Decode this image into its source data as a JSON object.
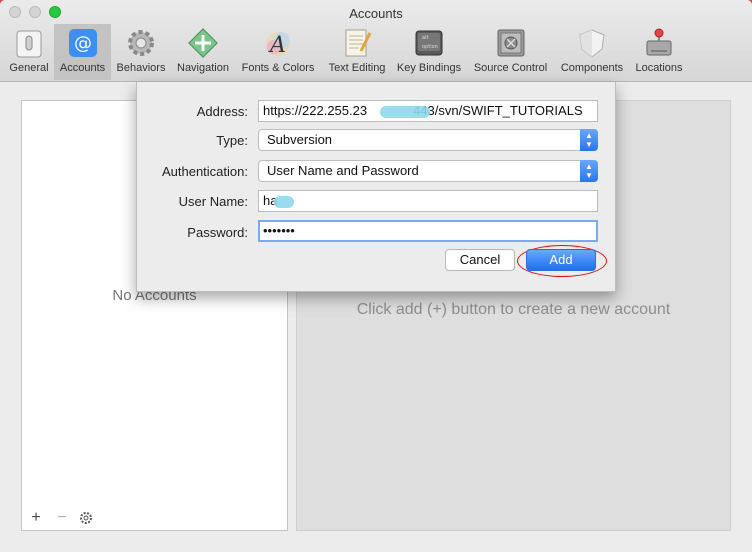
{
  "window": {
    "title": "Accounts"
  },
  "toolbar": {
    "items": [
      {
        "label": "General",
        "icon": "general-switch-icon",
        "active": false
      },
      {
        "label": "Accounts",
        "icon": "at-sign-icon",
        "active": true
      },
      {
        "label": "Behaviors",
        "icon": "gear-icon",
        "active": false
      },
      {
        "label": "Navigation",
        "icon": "navigation-arrows-icon",
        "active": false
      },
      {
        "label": "Fonts & Colors",
        "icon": "font-letter-icon",
        "active": false
      },
      {
        "label": "Text Editing",
        "icon": "text-document-icon",
        "active": false
      },
      {
        "label": "Key Bindings",
        "icon": "keyboard-key-icon",
        "active": false
      },
      {
        "label": "Source Control",
        "icon": "vault-icon",
        "active": false
      },
      {
        "label": "Components",
        "icon": "shield-icon",
        "active": false
      },
      {
        "label": "Locations",
        "icon": "disk-drive-icon",
        "active": false
      }
    ]
  },
  "accounts_list": {
    "empty_text": "No Accounts",
    "add_label": "+",
    "remove_label": "−",
    "settings_icon": "gear-icon"
  },
  "detail": {
    "hint": "Click add (+) button to create a new account"
  },
  "sheet": {
    "address_label": "Address:",
    "address_value_start": "https://222.255.23",
    "address_value_end": "443/svn/SWIFT_TUTORIALS",
    "type_label": "Type:",
    "type_value": "Subversion",
    "auth_label": "Authentication:",
    "auth_value": "User Name and Password",
    "username_label": "User Name:",
    "username_value": "ha",
    "password_label": "Password:",
    "password_value": "•••••••",
    "cancel_label": "Cancel",
    "add_label": "Add"
  },
  "colors": {
    "accent": "#2a74f0",
    "highlight_ring": "#dd1111",
    "desktop": "#c9483c"
  }
}
